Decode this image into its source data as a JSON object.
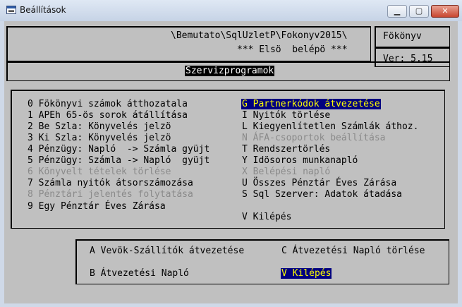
{
  "window": {
    "title": "Beállítások"
  },
  "header": {
    "path": "\\Bemutato\\SqlUzletP\\Fokonyv2015\\",
    "subtitle": "*** Elsö  belépö ***",
    "module": "Fökönyv",
    "version": "Ver: 5.15",
    "section": "Szervizprogramok"
  },
  "menu_left": [
    {
      "label": "0 Fökönyvi számok átthozatala",
      "enabled": true
    },
    {
      "label": "1 APEh 65-ös sorok átállítása",
      "enabled": true
    },
    {
      "label": "2 Be Szla: Könyvelés jelzö",
      "enabled": true
    },
    {
      "label": "3 Ki Szla: Könyvelés jelzö",
      "enabled": true
    },
    {
      "label": "4 Pénzügy: Napló  -> Számla gyüjt",
      "enabled": true
    },
    {
      "label": "5 Pénzügy: Számla -> Napló  gyüjt",
      "enabled": true
    },
    {
      "label": "6 Könyvelt tételek törlése",
      "enabled": false
    },
    {
      "label": "7 Számla nyitók átsorszámozása",
      "enabled": true
    },
    {
      "label": "8 Pénztári jelentés folytatása",
      "enabled": false
    },
    {
      "label": "9 Egy Pénztár Éves Zárása",
      "enabled": true
    }
  ],
  "menu_right": [
    {
      "label": "G Partnerkódok átvezetése",
      "enabled": true,
      "selected": true
    },
    {
      "label": "I Nyitók törlése",
      "enabled": true
    },
    {
      "label": "L Kiegyenlítetlen Számlák áthoz.",
      "enabled": true
    },
    {
      "label": "N ÁFA-csoportok beállítása",
      "enabled": false
    },
    {
      "label": "T Rendszertörlés",
      "enabled": true
    },
    {
      "label": "Y Idösoros munkanapló",
      "enabled": true
    },
    {
      "label": "X Belépési napló",
      "enabled": false
    },
    {
      "label": "U Összes Pénztár Éves Zárása",
      "enabled": true
    },
    {
      "label": "S Sql Szerver: Adatok átadása",
      "enabled": true
    },
    {
      "label": "",
      "enabled": true
    },
    {
      "label": "V Kilépés",
      "enabled": true
    }
  ],
  "submenu": {
    "a": "A Vevök-Szállítók átvezetése",
    "c": "C Átvezetési Napló törlése",
    "b": "B Átvezetési Napló",
    "v": "V Kilépés"
  },
  "colors": {
    "selection_bg": "#000080",
    "selection_fg": "#ffff00",
    "disabled": "#8a8a8a",
    "background": "#c0c0c0"
  }
}
